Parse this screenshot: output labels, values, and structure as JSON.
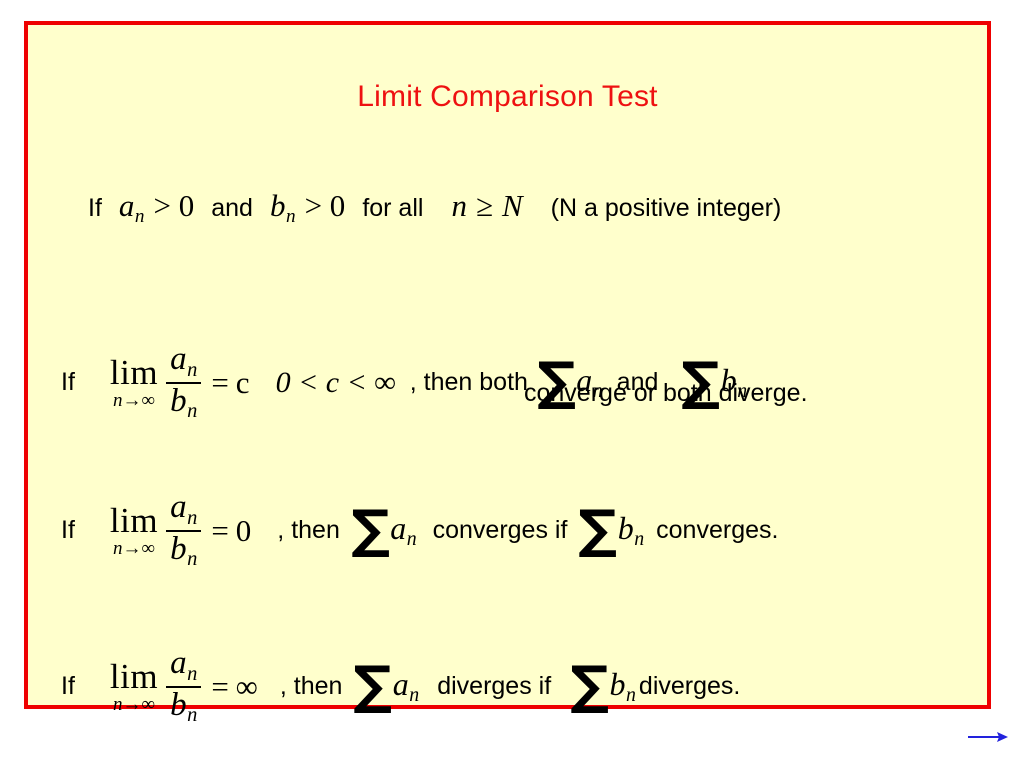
{
  "slide": {
    "title": "Limit Comparison Test",
    "title_color": "#ee1111",
    "background_color": "#ffffcc",
    "border_color": "#ee0000",
    "page_background": "#ffffff"
  },
  "condition": {
    "if_label": "If",
    "a_var": "a",
    "a_sub": "n",
    "a_rel": "> 0",
    "and_label": "and",
    "b_var": "b",
    "b_sub": "n",
    "b_rel": "> 0",
    "for_all_label": "for all",
    "n_var": "n",
    "n_rel": "≥",
    "N_var": "N",
    "note": "(N a positive integer)"
  },
  "statements": [
    {
      "if_label": "If",
      "lim_word": "lim",
      "lim_under_var": "n",
      "lim_under_arrow": "→",
      "lim_under_limit": "∞",
      "numerator": "a",
      "numerator_sub": "n",
      "denominator": "b",
      "denominator_sub": "n",
      "equals": "=",
      "limit_value": "c",
      "range_condition": "0 < c < ∞",
      "connector": ", then both",
      "sigma": "∑",
      "sum1_term": "a",
      "sum1_sub": "n",
      "mid_label": "and",
      "sum2_term": "b",
      "sum2_sub": "n",
      "tail": "",
      "second_line": "converge or both diverge."
    },
    {
      "if_label": "If",
      "lim_word": "lim",
      "lim_under_var": "n",
      "lim_under_arrow": "→",
      "lim_under_limit": "∞",
      "numerator": "a",
      "numerator_sub": "n",
      "denominator": "b",
      "denominator_sub": "n",
      "equals": "=",
      "limit_value": "0",
      "range_condition": "",
      "connector": ", then",
      "sigma": "∑",
      "sum1_term": "a",
      "sum1_sub": "n",
      "mid_label": "converges if",
      "sum2_term": "b",
      "sum2_sub": "n",
      "tail": "converges.",
      "second_line": ""
    },
    {
      "if_label": "If",
      "lim_word": "lim",
      "lim_under_var": "n",
      "lim_under_arrow": "→",
      "lim_under_limit": "∞",
      "numerator": "a",
      "numerator_sub": "n",
      "denominator": "b",
      "denominator_sub": "n",
      "equals": "=",
      "limit_value": "∞",
      "range_condition": "",
      "connector": ", then",
      "sigma": "∑",
      "sum1_term": "a",
      "sum1_sub": "n",
      "mid_label": "diverges if",
      "sum2_term": "b",
      "sum2_sub": "n",
      "tail": "diverges.",
      "second_line": ""
    }
  ],
  "navigation": {
    "next_arrow": "→",
    "next_arrow_color": "#2222dd"
  }
}
